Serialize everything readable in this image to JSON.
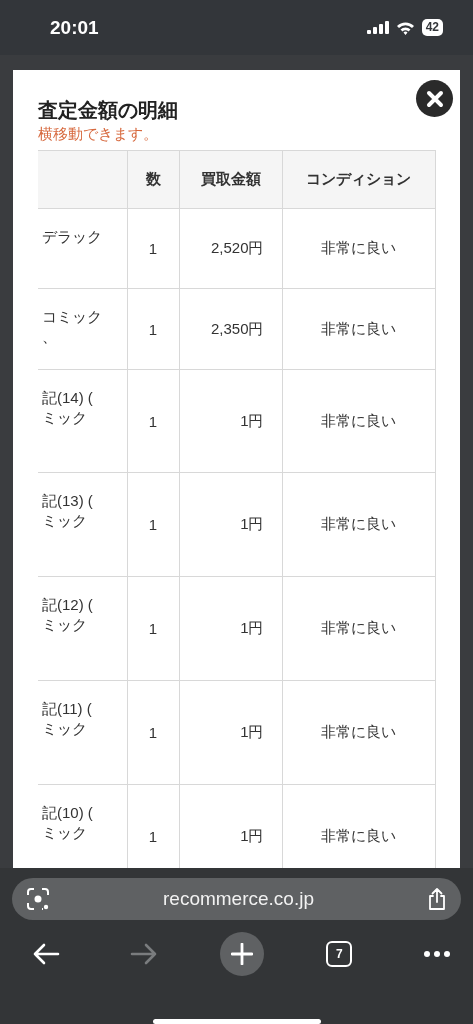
{
  "status_bar": {
    "time": "20:01",
    "battery": "42"
  },
  "modal": {
    "title": "査定金額の明細",
    "hint": "横移動できます。",
    "columns": [
      "数",
      "買取金額",
      "コンディション"
    ],
    "rows": [
      {
        "name": [
          "デラック"
        ],
        "qty": "1",
        "price": "2,520円",
        "condition": "非常に良い"
      },
      {
        "name": [
          "コミック",
          "、"
        ],
        "qty": "1",
        "price": "2,350円",
        "condition": "非常に良い"
      },
      {
        "name": [
          "記(14) (",
          "ミック"
        ],
        "qty": "1",
        "price": "1円",
        "condition": "非常に良い"
      },
      {
        "name": [
          "記(13) (",
          "ミック"
        ],
        "qty": "1",
        "price": "1円",
        "condition": "非常に良い"
      },
      {
        "name": [
          "記(12) (",
          "ミック"
        ],
        "qty": "1",
        "price": "1円",
        "condition": "非常に良い"
      },
      {
        "name": [
          "記(11) (",
          "ミック"
        ],
        "qty": "1",
        "price": "1円",
        "condition": "非常に良い"
      },
      {
        "name": [
          "記(10) (",
          "ミック"
        ],
        "qty": "1",
        "price": "1円",
        "condition": "非常に良い"
      }
    ]
  },
  "browser": {
    "url": "recommerce.co.jp",
    "toolbar": [
      {
        "kind": "back",
        "disabled": false
      },
      {
        "kind": "forward",
        "disabled": true
      },
      {
        "kind": "new-tab",
        "disabled": false
      },
      {
        "kind": "tabs",
        "label": "7",
        "disabled": false
      },
      {
        "kind": "more",
        "disabled": false
      }
    ]
  }
}
